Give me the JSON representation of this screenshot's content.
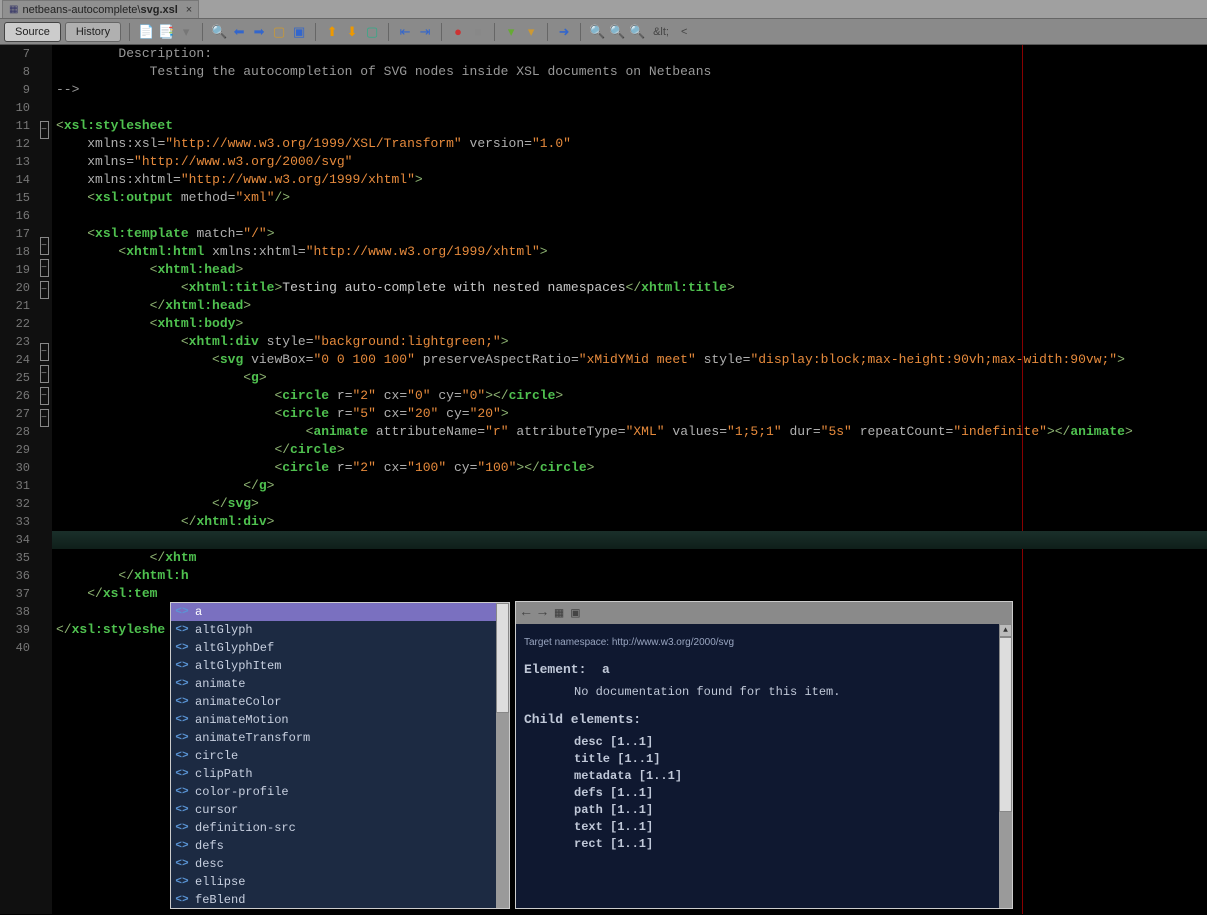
{
  "tab": {
    "path": "netbeans-autocomplete\\",
    "name": "svg.xsl"
  },
  "toolbar": {
    "source": "Source",
    "history": "History",
    "entity": "&lt;",
    "lt": "<"
  },
  "gutter": [
    "7",
    "8",
    "9",
    "10",
    "11",
    "12",
    "13",
    "14",
    "15",
    "16",
    "17",
    "18",
    "19",
    "20",
    "21",
    "22",
    "23",
    "24",
    "25",
    "26",
    "27",
    "28",
    "29",
    "30",
    "31",
    "32",
    "33",
    "34",
    "35",
    "36",
    "37",
    "38",
    "39",
    "40"
  ],
  "code": {
    "l1_a": "Description:",
    "l2_a": "Testing the autocompletion of SVG nodes inside XSL documents on Netbeans",
    "l3_a": "-->",
    "l5_tag": "xsl:stylesheet",
    "l6_attr": "xmlns:xsl",
    "l6_val": "\"http://www.w3.org/1999/XSL/Transform\"",
    "l6_attr2": "version",
    "l6_val2": "\"1.0\"",
    "l7_attr": "xmlns",
    "l7_val": "\"http://www.w3.org/2000/svg\"",
    "l8_attr": "xmlns:xhtml",
    "l8_val": "\"http://www.w3.org/1999/xhtml\"",
    "l9_tag": "xsl:output",
    "l9_attr": "method",
    "l9_val": "\"xml\"",
    "l11_tag": "xsl:template",
    "l11_attr": "match",
    "l11_val": "\"/\"",
    "l12_tag": "xhtml:html",
    "l12_attr": "xmlns:xhtml",
    "l12_val": "\"http://www.w3.org/1999/xhtml\"",
    "l13_tag": "xhtml:head",
    "l14_tag": "xhtml:title",
    "l14_txt": "Testing auto-complete with nested namespaces",
    "l15_tag": "xhtml:head",
    "l16_tag": "xhtml:body",
    "l17_tag": "xhtml:div",
    "l17_attr": "style",
    "l17_val": "\"background:lightgreen;\"",
    "l18_tag": "svg",
    "l18_a1": "viewBox",
    "l18_v1": "\"0 0 100 100\"",
    "l18_a2": "preserveAspectRatio",
    "l18_v2": "\"xMidYMid meet\"",
    "l18_a3": "style",
    "l18_v3": "\"display:block;max-height:90vh;max-width:90vw;\"",
    "l19_tag": "g",
    "l20_tag": "circle",
    "l20_a1": "r",
    "l20_v1": "\"2\"",
    "l20_a2": "cx",
    "l20_v2": "\"0\"",
    "l20_a3": "cy",
    "l20_v3": "\"0\"",
    "l21_tag": "circle",
    "l21_a1": "r",
    "l21_v1": "\"5\"",
    "l21_a2": "cx",
    "l21_v2": "\"20\"",
    "l21_a3": "cy",
    "l21_v3": "\"20\"",
    "l22_tag": "animate",
    "l22_a1": "attributeName",
    "l22_v1": "\"r\"",
    "l22_a2": "attributeType",
    "l22_v2": "\"XML\"",
    "l22_a3": "values",
    "l22_v3": "\"1;5;1\"",
    "l22_a4": "dur",
    "l22_v4": "\"5s\"",
    "l22_a5": "repeatCount",
    "l22_v5": "\"indefinite\"",
    "l23_tag": "circle",
    "l24_tag": "circle",
    "l24_a1": "r",
    "l24_v1": "\"2\"",
    "l24_a2": "cx",
    "l24_v2": "\"100\"",
    "l24_a3": "cy",
    "l24_v3": "\"100\"",
    "l25_tag": "g",
    "l26_tag": "svg",
    "l27_tag": "xhtml:div",
    "l29_tag": "xhtm",
    "l29_rest": "...",
    "l30_tag": "xhtml:h",
    "l30_rest": "...",
    "l31_tag": "xsl:tem",
    "l31_rest": "...",
    "l33_tag": "xsl:styleshe",
    "l33_rest": "..."
  },
  "popup": {
    "items": [
      "a",
      "altGlyph",
      "altGlyphDef",
      "altGlyphItem",
      "animate",
      "animateColor",
      "animateMotion",
      "animateTransform",
      "circle",
      "clipPath",
      "color-profile",
      "cursor",
      "definition-src",
      "defs",
      "desc",
      "ellipse",
      "feBlend"
    ]
  },
  "doc": {
    "ns": "Target namespace: http://www.w3.org/2000/svg",
    "elLabel": "Element:",
    "elName": "a",
    "nodoc": "No documentation found for this item.",
    "childLabel": "Child elements:",
    "children": [
      "desc [1..1]",
      "title [1..1]",
      "metadata [1..1]",
      "defs [1..1]",
      "path [1..1]",
      "text [1..1]",
      "rect [1..1]"
    ]
  }
}
